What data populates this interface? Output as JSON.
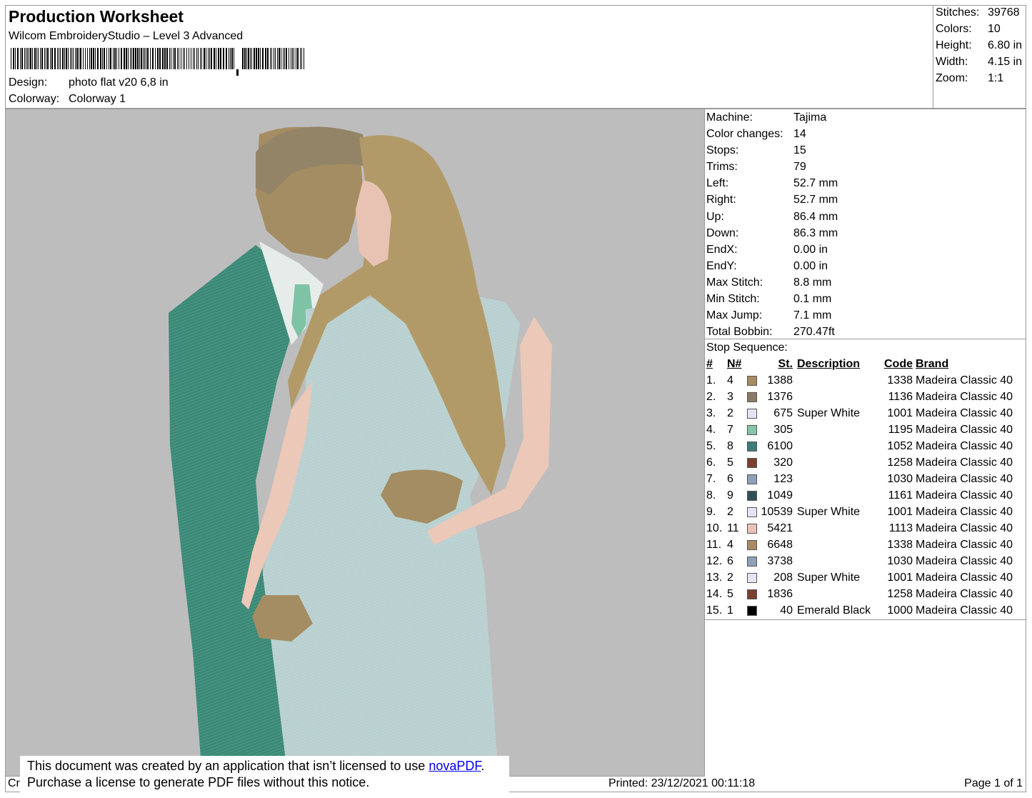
{
  "header": {
    "title": "Production Worksheet",
    "software": "Wilcom EmbroideryStudio – Level 3 Advanced",
    "design_label": "Design:",
    "design_value": "photo flat v20 6,8 in",
    "colorway_label": "Colorway:",
    "colorway_value": "Colorway 1"
  },
  "stats": [
    {
      "label": "Stitches:",
      "value": "39768"
    },
    {
      "label": "Colors:",
      "value": "10"
    },
    {
      "label": "Height:",
      "value": "6.80 in"
    },
    {
      "label": "Width:",
      "value": "4.15 in"
    },
    {
      "label": "Zoom:",
      "value": "1:1"
    }
  ],
  "machine_info": [
    {
      "label": "Machine:",
      "value": "Tajima"
    },
    {
      "label": "Color changes:",
      "value": "14"
    },
    {
      "label": "Stops:",
      "value": "15"
    },
    {
      "label": "Trims:",
      "value": "79"
    },
    {
      "label": "Left:",
      "value": "52.7 mm"
    },
    {
      "label": "Right:",
      "value": "52.7 mm"
    },
    {
      "label": "Up:",
      "value": "86.4 mm"
    },
    {
      "label": "Down:",
      "value": "86.3 mm"
    },
    {
      "label": "EndX:",
      "value": "0.00 in"
    },
    {
      "label": "EndY:",
      "value": "0.00 in"
    },
    {
      "label": "Max Stitch:",
      "value": "8.8 mm"
    },
    {
      "label": "Min Stitch:",
      "value": "0.1 mm"
    },
    {
      "label": "Max Jump:",
      "value": "7.1 mm"
    },
    {
      "label": "Total Bobbin:",
      "value": "270.47ft"
    }
  ],
  "stop_sequence": {
    "title": "Stop Sequence:",
    "headers": {
      "idx": "#",
      "n": "N#",
      "st": "St.",
      "desc": "Description",
      "code": "Code",
      "brand": "Brand"
    },
    "rows": [
      {
        "idx": "1.",
        "n": "4",
        "color": "#a98b62",
        "st": "1388",
        "desc": "",
        "code": "1338",
        "brand": "Madeira Classic 40"
      },
      {
        "idx": "2.",
        "n": "3",
        "color": "#8b7a68",
        "st": "1376",
        "desc": "",
        "code": "1136",
        "brand": "Madeira Classic 40"
      },
      {
        "idx": "3.",
        "n": "2",
        "color": "#e4e4f4",
        "st": "675",
        "desc": "Super White",
        "code": "1001",
        "brand": "Madeira Classic 40"
      },
      {
        "idx": "4.",
        "n": "7",
        "color": "#85c5a8",
        "st": "305",
        "desc": "",
        "code": "1195",
        "brand": "Madeira Classic 40"
      },
      {
        "idx": "5.",
        "n": "8",
        "color": "#3b7d78",
        "st": "6100",
        "desc": "",
        "code": "1052",
        "brand": "Madeira Classic 40"
      },
      {
        "idx": "6.",
        "n": "5",
        "color": "#7d4030",
        "st": "320",
        "desc": "",
        "code": "1258",
        "brand": "Madeira Classic 40"
      },
      {
        "idx": "7.",
        "n": "6",
        "color": "#8ea0b8",
        "st": "123",
        "desc": "",
        "code": "1030",
        "brand": "Madeira Classic 40"
      },
      {
        "idx": "8.",
        "n": "9",
        "color": "#2f4f55",
        "st": "1049",
        "desc": "",
        "code": "1161",
        "brand": "Madeira Classic 40"
      },
      {
        "idx": "9.",
        "n": "2",
        "color": "#e4e4f4",
        "st": "10539",
        "desc": "Super White",
        "code": "1001",
        "brand": "Madeira Classic 40"
      },
      {
        "idx": "10.",
        "n": "11",
        "color": "#ecc2b6",
        "st": "5421",
        "desc": "",
        "code": "1113",
        "brand": "Madeira Classic 40"
      },
      {
        "idx": "11.",
        "n": "4",
        "color": "#a98b62",
        "st": "6648",
        "desc": "",
        "code": "1338",
        "brand": "Madeira Classic 40"
      },
      {
        "idx": "12.",
        "n": "6",
        "color": "#8ea0b8",
        "st": "3738",
        "desc": "",
        "code": "1030",
        "brand": "Madeira Classic 40"
      },
      {
        "idx": "13.",
        "n": "2",
        "color": "#e4e4f4",
        "st": "208",
        "desc": "Super White",
        "code": "1001",
        "brand": "Madeira Classic 40"
      },
      {
        "idx": "14.",
        "n": "5",
        "color": "#7d4030",
        "st": "1836",
        "desc": "",
        "code": "1258",
        "brand": "Madeira Classic 40"
      },
      {
        "idx": "15.",
        "n": "1",
        "color": "#000000",
        "st": "40",
        "desc": "Emerald Black",
        "code": "1000",
        "brand": "Madeira Classic 40"
      }
    ]
  },
  "footer": {
    "left": "Cr",
    "printed": "Printed: 23/12/2021 00:11:18",
    "page": "Page 1 of 1"
  },
  "notice": {
    "line1_pre": "This document was created by an application that isn’t licensed to use ",
    "link": "novaPDF",
    "line1_post": ".",
    "line2": "Purchase a license to generate PDF files without this notice."
  }
}
